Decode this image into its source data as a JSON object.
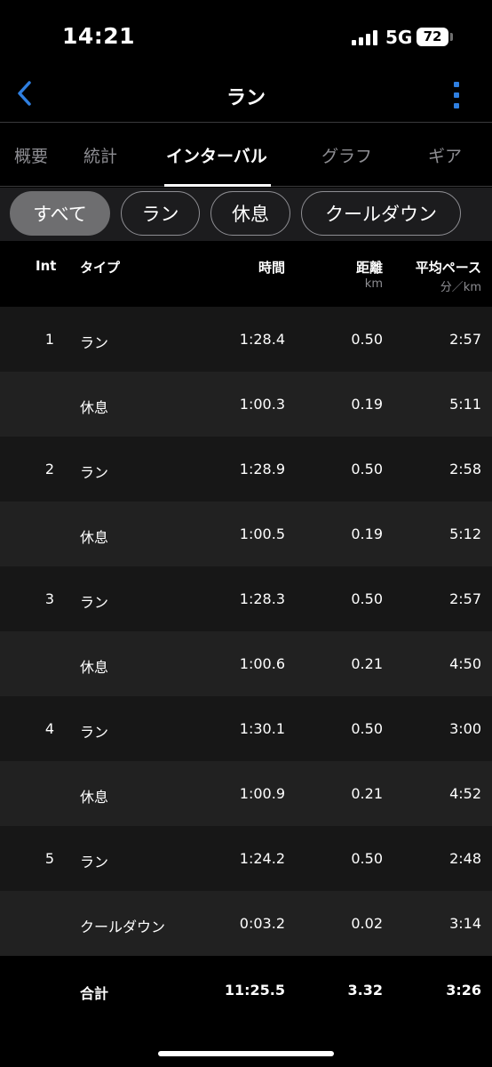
{
  "status_bar": {
    "time": "14:21",
    "network": "5G",
    "battery": "72",
    "icons": [
      "signal-bars-icon",
      "battery-icon"
    ]
  },
  "nav": {
    "title": "ラン",
    "back_icon": "chevron-left-icon",
    "more_icon": "more-vertical-icon",
    "accent_color": "#2f7fe0"
  },
  "tabs": [
    {
      "label": "概要",
      "active": false
    },
    {
      "label": "統計",
      "active": false
    },
    {
      "label": "インターバル",
      "active": true
    },
    {
      "label": "グラフ",
      "active": false
    },
    {
      "label": "ギア",
      "active": false
    }
  ],
  "filters": [
    {
      "label": "すべて",
      "active": true
    },
    {
      "label": "ラン",
      "active": false
    },
    {
      "label": "休息",
      "active": false
    },
    {
      "label": "クールダウン",
      "active": false
    }
  ],
  "table": {
    "headers": {
      "int": "Int",
      "type": "タイプ",
      "time": "時間",
      "distance": "距離",
      "distance_unit": "km",
      "pace": "平均ペース",
      "pace_unit": "分／km"
    },
    "rows": [
      {
        "int": "1",
        "type": "ラン",
        "time": "1:28.4",
        "distance": "0.50",
        "pace": "2:57"
      },
      {
        "int": "",
        "type": "休息",
        "time": "1:00.3",
        "distance": "0.19",
        "pace": "5:11"
      },
      {
        "int": "2",
        "type": "ラン",
        "time": "1:28.9",
        "distance": "0.50",
        "pace": "2:58"
      },
      {
        "int": "",
        "type": "休息",
        "time": "1:00.5",
        "distance": "0.19",
        "pace": "5:12"
      },
      {
        "int": "3",
        "type": "ラン",
        "time": "1:28.3",
        "distance": "0.50",
        "pace": "2:57"
      },
      {
        "int": "",
        "type": "休息",
        "time": "1:00.6",
        "distance": "0.21",
        "pace": "4:50"
      },
      {
        "int": "4",
        "type": "ラン",
        "time": "1:30.1",
        "distance": "0.50",
        "pace": "3:00"
      },
      {
        "int": "",
        "type": "休息",
        "time": "1:00.9",
        "distance": "0.21",
        "pace": "4:52"
      },
      {
        "int": "5",
        "type": "ラン",
        "time": "1:24.2",
        "distance": "0.50",
        "pace": "2:48"
      },
      {
        "int": "",
        "type": "クールダウン",
        "time": "0:03.2",
        "distance": "0.02",
        "pace": "3:14"
      }
    ],
    "total": {
      "label": "合計",
      "time": "11:25.5",
      "distance": "3.32",
      "pace": "3:26"
    },
    "row_colors": [
      "#171717",
      "#212121"
    ]
  }
}
